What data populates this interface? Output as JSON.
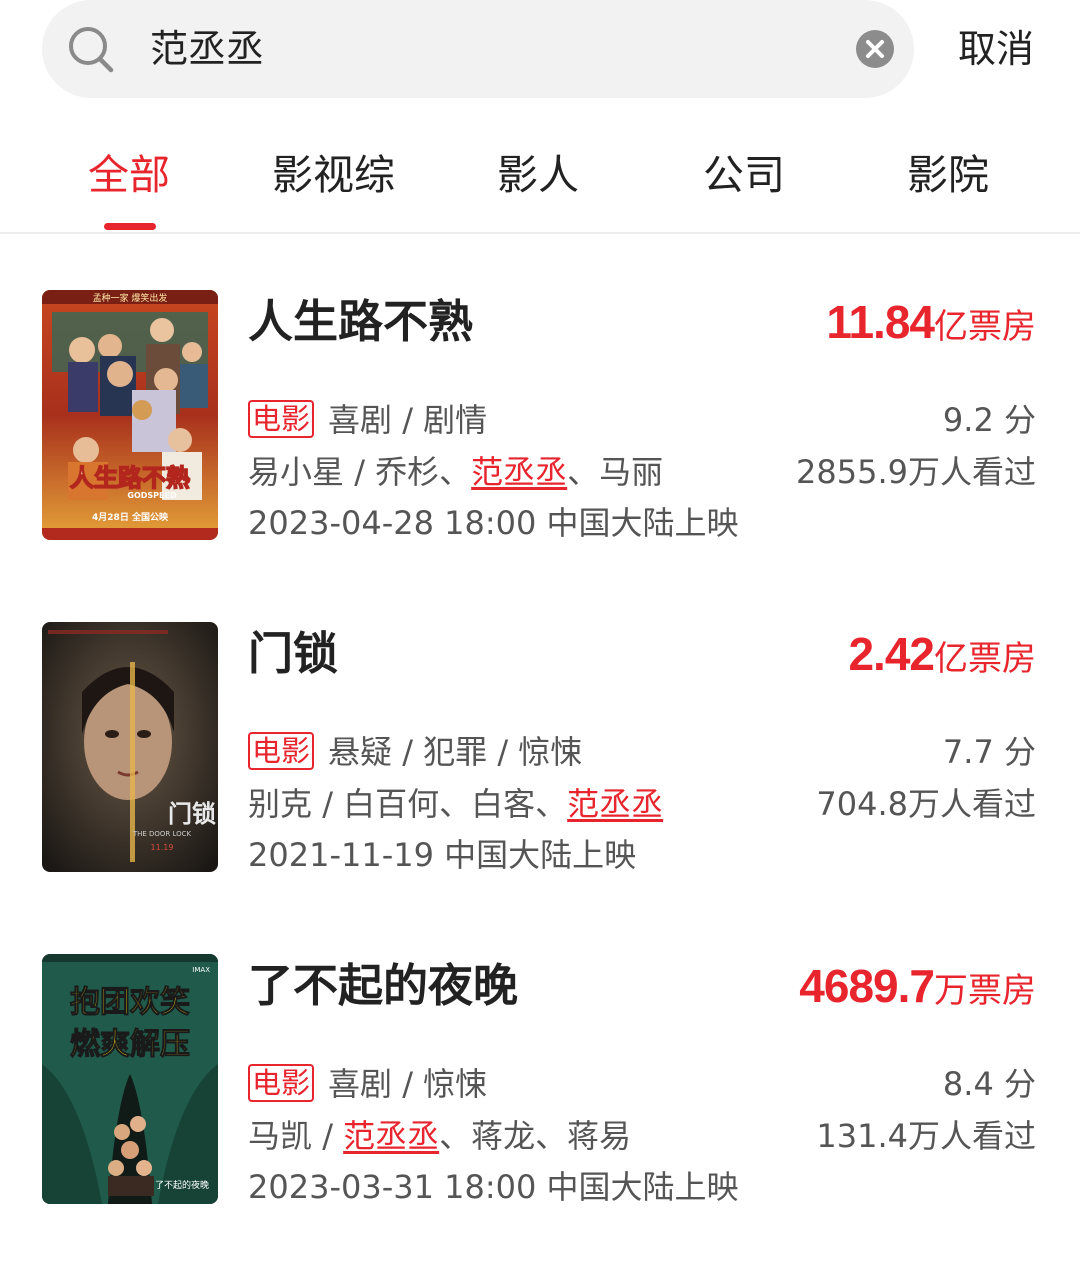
{
  "search": {
    "query": "范丞丞",
    "cancel_label": "取消"
  },
  "tabs": [
    {
      "label": "全部",
      "active": true
    },
    {
      "label": "影视综",
      "active": false
    },
    {
      "label": "影人",
      "active": false
    },
    {
      "label": "公司",
      "active": false
    },
    {
      "label": "影院",
      "active": false
    }
  ],
  "colors": {
    "accent": "#e8242d",
    "text": "#222222",
    "secondary": "#555555"
  },
  "results": [
    {
      "title": "人生路不熟",
      "box_office_value": "11.84",
      "box_office_unit": "亿票房",
      "tag": "电影",
      "genres": "喜剧 / 剧情",
      "score": "9.2 分",
      "director": "易小星",
      "cast_before": "乔杉、",
      "cast_highlight": "范丞丞",
      "cast_after": "、马丽",
      "viewers": "2855.9万人看过",
      "release": "2023-04-28 18:00 中国大陆上映",
      "poster": {
        "top_text": "孟种一家  爆笑出发",
        "title_text": "人生路不熟",
        "en": "GODSPEED",
        "date_text": "4月28日 全国公映"
      }
    },
    {
      "title": "门锁",
      "box_office_value": "2.42",
      "box_office_unit": "亿票房",
      "tag": "电影",
      "genres": "悬疑 / 犯罪 / 惊悚",
      "score": "7.7 分",
      "director": "别克",
      "cast_before": "白百何、白客、",
      "cast_highlight": "范丞丞",
      "cast_after": "",
      "viewers": "704.8万人看过",
      "release": "2021-11-19 中国大陆上映",
      "poster": {
        "title_text": "门锁",
        "en": "THE DOOR LOCK",
        "date_text": "11.19"
      }
    },
    {
      "title": "了不起的夜晚",
      "box_office_value": "4689.7",
      "box_office_unit": "万票房",
      "tag": "电影",
      "genres": "喜剧 / 惊悚",
      "score": "8.4 分",
      "director": "马凯",
      "cast_before": "",
      "cast_highlight": "范丞丞",
      "cast_after": "、蒋龙、蒋易",
      "viewers": "131.4万人看过",
      "release": "2023-03-31 18:00 中国大陆上映",
      "poster": {
        "slogan_1": "抱团欢笑",
        "slogan_2": "燃爽解压",
        "title_text": "了不起的夜晚",
        "imax": "IMAX"
      }
    }
  ]
}
